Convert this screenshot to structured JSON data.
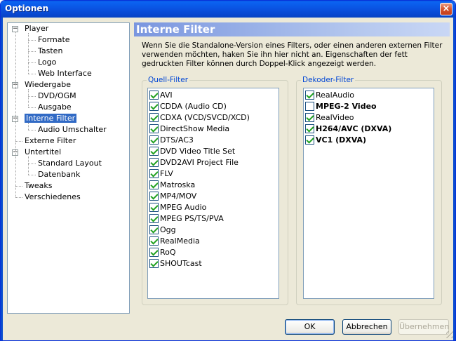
{
  "window": {
    "title": "Optionen",
    "close_glyph": "×"
  },
  "tree": {
    "items": [
      {
        "label": "Player",
        "level": 0,
        "expander": "−"
      },
      {
        "label": "Formate",
        "level": 1
      },
      {
        "label": "Tasten",
        "level": 1
      },
      {
        "label": "Logo",
        "level": 1
      },
      {
        "label": "Web Interface",
        "level": 1
      },
      {
        "label": "Wiedergabe",
        "level": 0,
        "expander": "−"
      },
      {
        "label": "DVD/OGM",
        "level": 1
      },
      {
        "label": "Ausgabe",
        "level": 1
      },
      {
        "label": "Interne Filter",
        "level": 0,
        "expander": "−",
        "selected": true
      },
      {
        "label": "Audio Umschalter",
        "level": 1
      },
      {
        "label": "Externe Filter",
        "level": 0
      },
      {
        "label": "Untertitel",
        "level": 0,
        "expander": "−"
      },
      {
        "label": "Standard Layout",
        "level": 1
      },
      {
        "label": "Datenbank",
        "level": 1
      },
      {
        "label": "Tweaks",
        "level": 0
      },
      {
        "label": "Verschiedenes",
        "level": 0
      }
    ]
  },
  "panel": {
    "header": "Interne Filter",
    "description": "Wenn Sie die Standalone-Version eines Filters, oder einen anderen externen Filter verwenden möchten, haken Sie ihn hier nicht an. Eigenschaften der fett gedruckten Filter können durch Doppel-Klick angezeigt werden."
  },
  "source_filters": {
    "title": "Quell-Filter",
    "items": [
      {
        "label": "AVI",
        "checked": true
      },
      {
        "label": "CDDA (Audio CD)",
        "checked": true
      },
      {
        "label": "CDXA (VCD/SVCD/XCD)",
        "checked": true
      },
      {
        "label": "DirectShow Media",
        "checked": true
      },
      {
        "label": "DTS/AC3",
        "checked": true
      },
      {
        "label": "DVD Video Title Set",
        "checked": true
      },
      {
        "label": "DVD2AVI Project File",
        "checked": true
      },
      {
        "label": "FLV",
        "checked": true
      },
      {
        "label": "Matroska",
        "checked": true
      },
      {
        "label": "MP4/MOV",
        "checked": true
      },
      {
        "label": "MPEG Audio",
        "checked": true
      },
      {
        "label": "MPEG PS/TS/PVA",
        "checked": true
      },
      {
        "label": "Ogg",
        "checked": true
      },
      {
        "label": "RealMedia",
        "checked": true
      },
      {
        "label": "RoQ",
        "checked": true
      },
      {
        "label": "SHOUTcast",
        "checked": true
      }
    ]
  },
  "decoder_filters": {
    "title": "Dekoder-Filter",
    "items": [
      {
        "label": "RealAudio",
        "checked": true,
        "bold": false
      },
      {
        "label": "MPEG-2 Video",
        "checked": false,
        "bold": true
      },
      {
        "label": "RealVideo",
        "checked": true,
        "bold": false
      },
      {
        "label": "H264/AVC (DXVA)",
        "checked": true,
        "bold": true
      },
      {
        "label": "VC1 (DXVA)",
        "checked": true,
        "bold": true
      }
    ]
  },
  "buttons": {
    "ok": "OK",
    "cancel": "Abbrechen",
    "apply": "Übernehmen"
  }
}
